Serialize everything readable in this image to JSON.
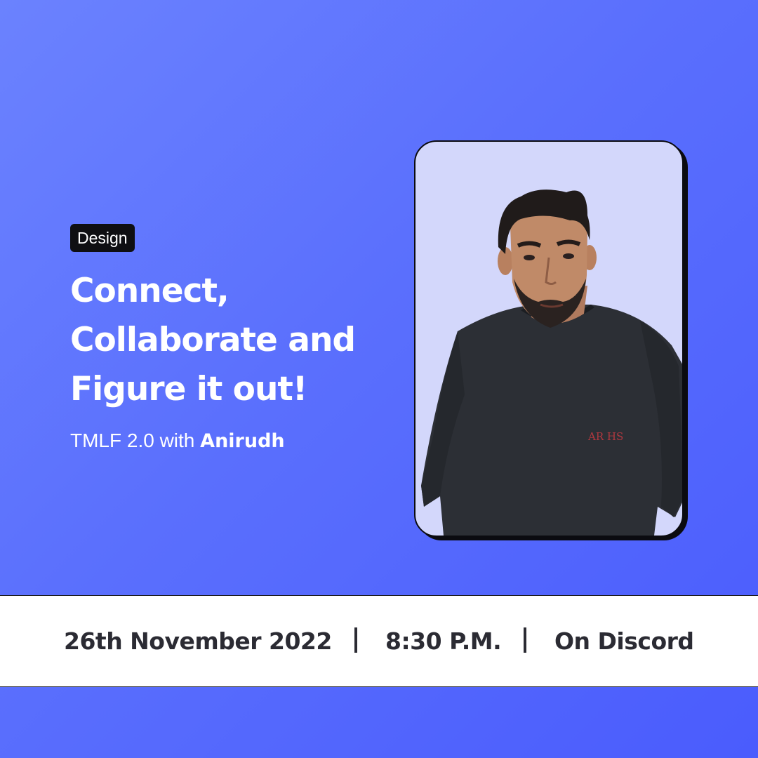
{
  "tag": {
    "label": "Design"
  },
  "headline": {
    "lines": [
      "Connect,",
      "Collaborate and",
      "Figure it out!"
    ]
  },
  "subline": {
    "prefix": "TMLF 2.0 with ",
    "host": "Anirudh"
  },
  "event": {
    "date": "26th November 2022",
    "time": "8:30 P.M.",
    "venue": "On Discord"
  },
  "photo": {
    "subject": "speaker-portrait",
    "shirt_print": "AR HS"
  },
  "colors": {
    "background_start": "#6b82fe",
    "background_end": "#4a5cfd",
    "tag_bg": "#0f0f12",
    "photo_bg": "#d3d7fb",
    "info_text": "#2b2b33"
  }
}
